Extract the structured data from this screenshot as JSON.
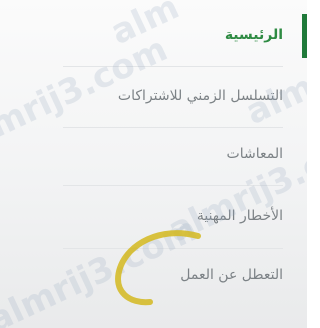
{
  "nav": {
    "items": [
      {
        "label": "الرئيسية",
        "active": true
      },
      {
        "label": "التسلسل الزمني للاشتراكات",
        "active": false
      },
      {
        "label": "المعاشات",
        "active": false
      },
      {
        "label": "الأخطار المهنية",
        "active": false
      },
      {
        "label": "التعطل عن العمل",
        "active": false
      }
    ]
  },
  "colors": {
    "active_text": "#2e8b43",
    "active_bar": "#1f7a3a",
    "inactive_text": "#7c8286",
    "highlight_stroke": "#d4b81f"
  },
  "watermark": {
    "lines": [
      "alm",
      "almrij3.com",
      "alm",
      "almrij3.com",
      "almrij3.com"
    ]
  }
}
